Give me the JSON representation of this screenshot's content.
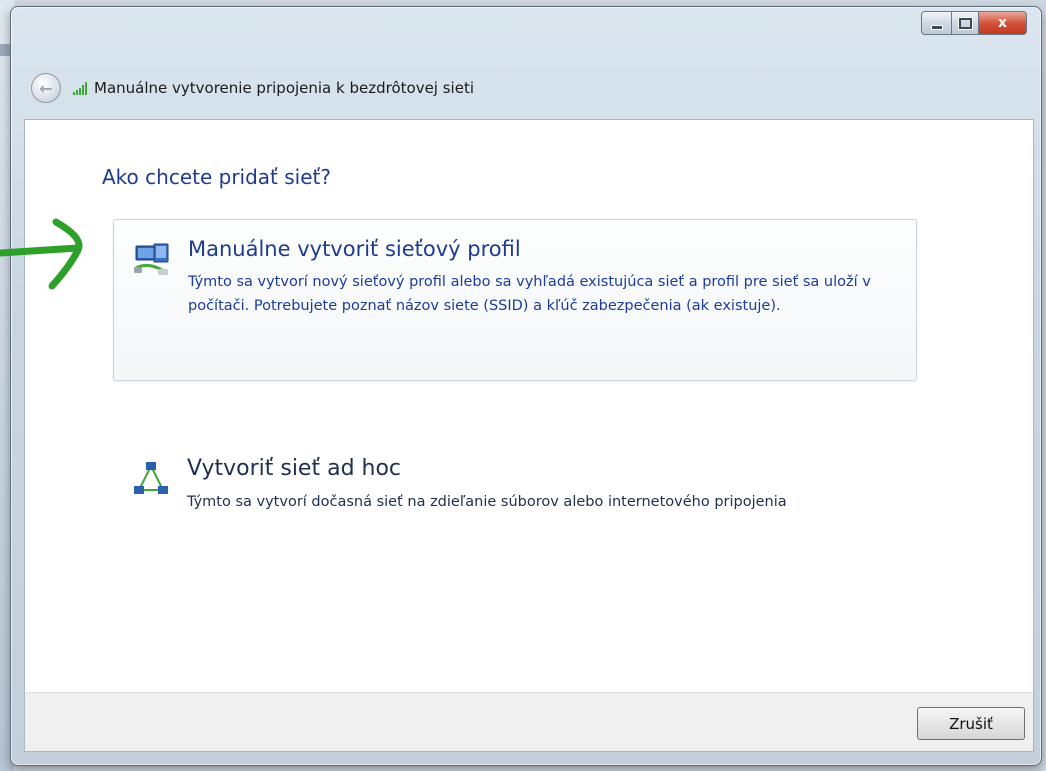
{
  "window": {
    "title": "Manuálne vytvorenie pripojenia k bezdrôtovej sieti",
    "close_label": "x"
  },
  "page": {
    "heading": "Ako chcete pridať sieť?"
  },
  "options": [
    {
      "icon": "network-profile-icon",
      "title": "Manuálne vytvoriť sieťový profil",
      "description": "Týmto sa vytvorí nový sieťový profil alebo sa vyhľadá existujúca sieť a profil pre sieť sa uloží v počítači. Potrebujete poznať názov siete (SSID) a kľúč zabezpečenia (ak existuje).",
      "selected": true
    },
    {
      "icon": "ad-hoc-network-icon",
      "title": "Vytvoriť sieť ad hoc",
      "description": "Týmto sa vytvorí dočasná sieť na zdieľanie súborov alebo internetového pripojenia",
      "selected": false
    }
  ],
  "footer": {
    "cancel_label": "Zrušiť"
  },
  "colors": {
    "link_blue": "#1e3b8f",
    "annotation_green": "#2ea02a"
  }
}
